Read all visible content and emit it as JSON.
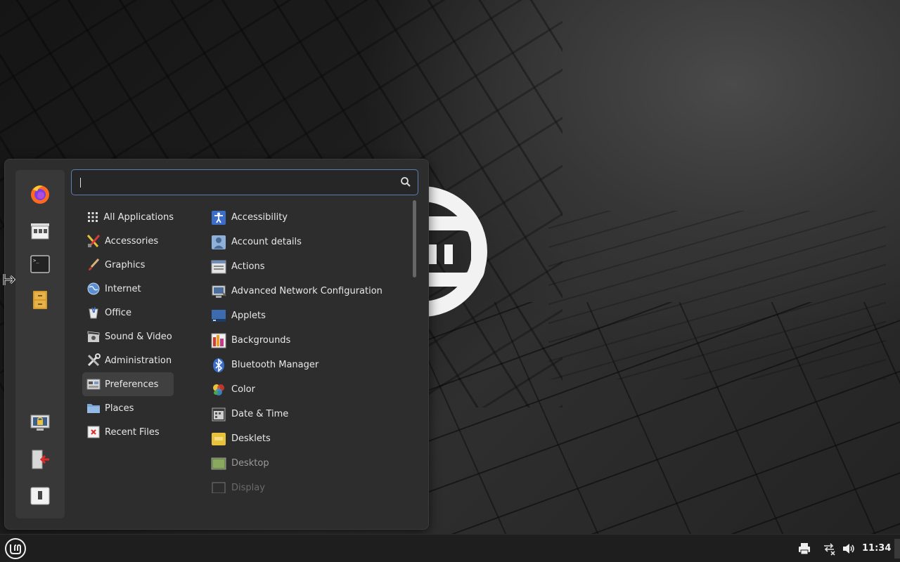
{
  "search": {
    "value": "",
    "placeholder": ""
  },
  "favorites": [
    {
      "name": "firefox-icon"
    },
    {
      "name": "software-manager-icon"
    },
    {
      "name": "terminal-icon"
    },
    {
      "name": "file-manager-icon"
    }
  ],
  "session": [
    {
      "name": "lock-screen-icon"
    },
    {
      "name": "logout-icon"
    },
    {
      "name": "shutdown-icon"
    }
  ],
  "categories": [
    {
      "label": "All Applications",
      "icon": "grid-icon"
    },
    {
      "label": "Accessories",
      "icon": "accessories-icon"
    },
    {
      "label": "Graphics",
      "icon": "graphics-icon"
    },
    {
      "label": "Internet",
      "icon": "internet-icon"
    },
    {
      "label": "Office",
      "icon": "office-icon"
    },
    {
      "label": "Sound & Video",
      "icon": "sound-video-icon"
    },
    {
      "label": "Administration",
      "icon": "administration-icon"
    },
    {
      "label": "Preferences",
      "icon": "preferences-icon",
      "selected": true
    },
    {
      "label": "Places",
      "icon": "folder-icon"
    },
    {
      "label": "Recent Files",
      "icon": "recent-files-icon"
    }
  ],
  "apps": [
    {
      "label": "Accessibility",
      "icon": "accessibility-icon"
    },
    {
      "label": "Account details",
      "icon": "account-icon"
    },
    {
      "label": "Actions",
      "icon": "actions-icon"
    },
    {
      "label": "Advanced Network Configuration",
      "icon": "network-config-icon"
    },
    {
      "label": "Applets",
      "icon": "applets-icon"
    },
    {
      "label": "Backgrounds",
      "icon": "backgrounds-icon"
    },
    {
      "label": "Bluetooth Manager",
      "icon": "bluetooth-icon"
    },
    {
      "label": "Color",
      "icon": "color-icon"
    },
    {
      "label": "Date & Time",
      "icon": "date-time-icon"
    },
    {
      "label": "Desklets",
      "icon": "desklets-icon"
    },
    {
      "label": "Desktop",
      "icon": "desktop-icon"
    },
    {
      "label": "Display",
      "icon": "display-icon"
    }
  ],
  "panel": {
    "clock": "11:34",
    "tray": [
      "printer-icon",
      "network-disconnected-icon",
      "volume-icon"
    ]
  },
  "colors": {
    "accent": "#5d7fb0",
    "menu_bg": "#2d2d2d",
    "panel_bg": "#1e1e1e"
  }
}
